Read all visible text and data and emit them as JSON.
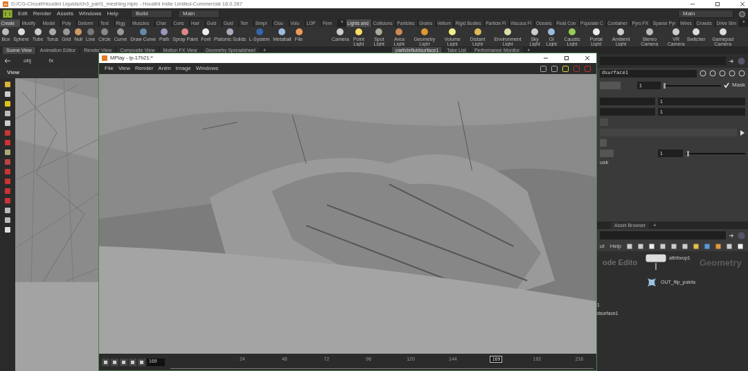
{
  "window": {
    "title": "D:/CG-Circuit/Houdini Liquids/ch3_part1_meshing.hiplc - Houdini Indie Limited-Commercial 18.0.287"
  },
  "menu": [
    "Edit",
    "Render",
    "Assets",
    "Windows",
    "Help"
  ],
  "desktop": {
    "build": "Build",
    "main": "Main",
    "right": "Main"
  },
  "shelf_tabs_left": [
    {
      "label": "Create",
      "selected": true
    },
    {
      "label": "Modify",
      "selected": false
    },
    {
      "label": "Model",
      "selected": false
    },
    {
      "label": "Poly",
      "selected": false
    },
    {
      "label": "Deform",
      "selected": false
    },
    {
      "label": "Text",
      "selected": false
    },
    {
      "label": "Rigg",
      "selected": false
    },
    {
      "label": "Muscles",
      "selected": false
    },
    {
      "label": "Char",
      "selected": false
    },
    {
      "label": "Cons",
      "selected": false
    },
    {
      "label": "Hair",
      "selected": false
    },
    {
      "label": "Guid",
      "selected": false
    },
    {
      "label": "Guid",
      "selected": false
    },
    {
      "label": "Terr",
      "selected": false
    },
    {
      "label": "Simpl",
      "selected": false
    },
    {
      "label": "Clou",
      "selected": false
    },
    {
      "label": "Volu",
      "selected": false
    },
    {
      "label": "LOP",
      "selected": false
    },
    {
      "label": "Fem",
      "selected": false
    }
  ],
  "shelf_tabs_right": [
    {
      "label": "Lights and",
      "selected": true
    },
    {
      "label": "Collisions",
      "selected": false
    },
    {
      "label": "Particles",
      "selected": false
    },
    {
      "label": "Grains",
      "selected": false
    },
    {
      "label": "Vellum",
      "selected": false
    },
    {
      "label": "Rigid Bodies",
      "selected": false
    },
    {
      "label": "Particle Fl",
      "selected": false
    },
    {
      "label": "Viscous Fl",
      "selected": false
    },
    {
      "label": "Oceans",
      "selected": false
    },
    {
      "label": "Fluid Con",
      "selected": false
    },
    {
      "label": "Populate C",
      "selected": false
    },
    {
      "label": "Container",
      "selected": false
    },
    {
      "label": "Pyro FX",
      "selected": false
    },
    {
      "label": "Sparse Pyr",
      "selected": false
    },
    {
      "label": "Wires",
      "selected": false
    },
    {
      "label": "Crowds",
      "selected": false
    },
    {
      "label": "Drive Sim",
      "selected": false
    }
  ],
  "shelf_tools_left": [
    "Box",
    "Sphere",
    "Tube",
    "Torus",
    "Grid",
    "Null",
    "Line",
    "Circle",
    "Curve",
    "Draw Curve",
    "Path",
    "Spray Paint",
    "Font",
    "Platonic Solids",
    "L-System",
    "Metaball",
    "File"
  ],
  "shelf_tools_right": [
    "Camera",
    "Point Light",
    "Spot Light",
    "Area Light",
    "Geometry Light",
    "Volume Light",
    "Distant Light",
    "Environment Light",
    "Sky Light",
    "GI Light",
    "Caustic Light",
    "Portal Light",
    "Ambient Light",
    "Stereo Camera",
    "VR Camera",
    "Switcher",
    "Gamepad Camera"
  ],
  "pane_tabs_left": [
    {
      "label": "Scene View",
      "selected": true
    },
    {
      "label": "Animation Editor",
      "selected": false
    },
    {
      "label": "Render View",
      "selected": false
    },
    {
      "label": "Composite View",
      "selected": false
    },
    {
      "label": "Motion FX View",
      "selected": false
    },
    {
      "label": "Geometry Spreadsheet",
      "selected": false
    }
  ],
  "pane_tabs_right": [
    {
      "label": "particlefluidsurface1",
      "selected": true
    },
    {
      "label": "Take List",
      "selected": false
    },
    {
      "label": "Performance Monitor",
      "selected": false
    }
  ],
  "shelf_add": [
    "+",
    "+"
  ],
  "pane_add": [
    "+",
    "+"
  ],
  "path": [
    "obj",
    "fx"
  ],
  "viewer": {
    "label": "View"
  },
  "mplay": {
    "title": "MPlay - ip-17h21:*",
    "menu": [
      "File",
      "View",
      "Render",
      "Anim",
      "Image",
      "Windows"
    ],
    "frame": "169",
    "timeline": {
      "ticks_before": [
        "24",
        "48",
        "72",
        "96",
        "120",
        "144"
      ],
      "ticks_after": [
        "192",
        "216"
      ],
      "current": "169",
      "level": 0.77
    }
  },
  "parameters": {
    "node_name": "dsurface1",
    "value_1": "1",
    "mask": {
      "label": "Mask",
      "checked": true
    },
    "value_2": "1",
    "value_3": "1",
    "value_4": "1",
    "sliders": [
      {
        "level": 0.0
      },
      {
        "level": 0.02
      }
    ],
    "partial_label": "usk"
  },
  "network": {
    "tab": "Asset Browser",
    "add": "+",
    "menu": [
      "ut",
      "Help"
    ],
    "context": "Geometry",
    "editor_label": "ode Edito",
    "nodes": [
      {
        "name": "attribvop1",
        "kind": "vop"
      },
      {
        "name": "OUT_flip_points",
        "kind": "null"
      }
    ],
    "partial_node": "dsurface1",
    "partial_digit": "1"
  }
}
